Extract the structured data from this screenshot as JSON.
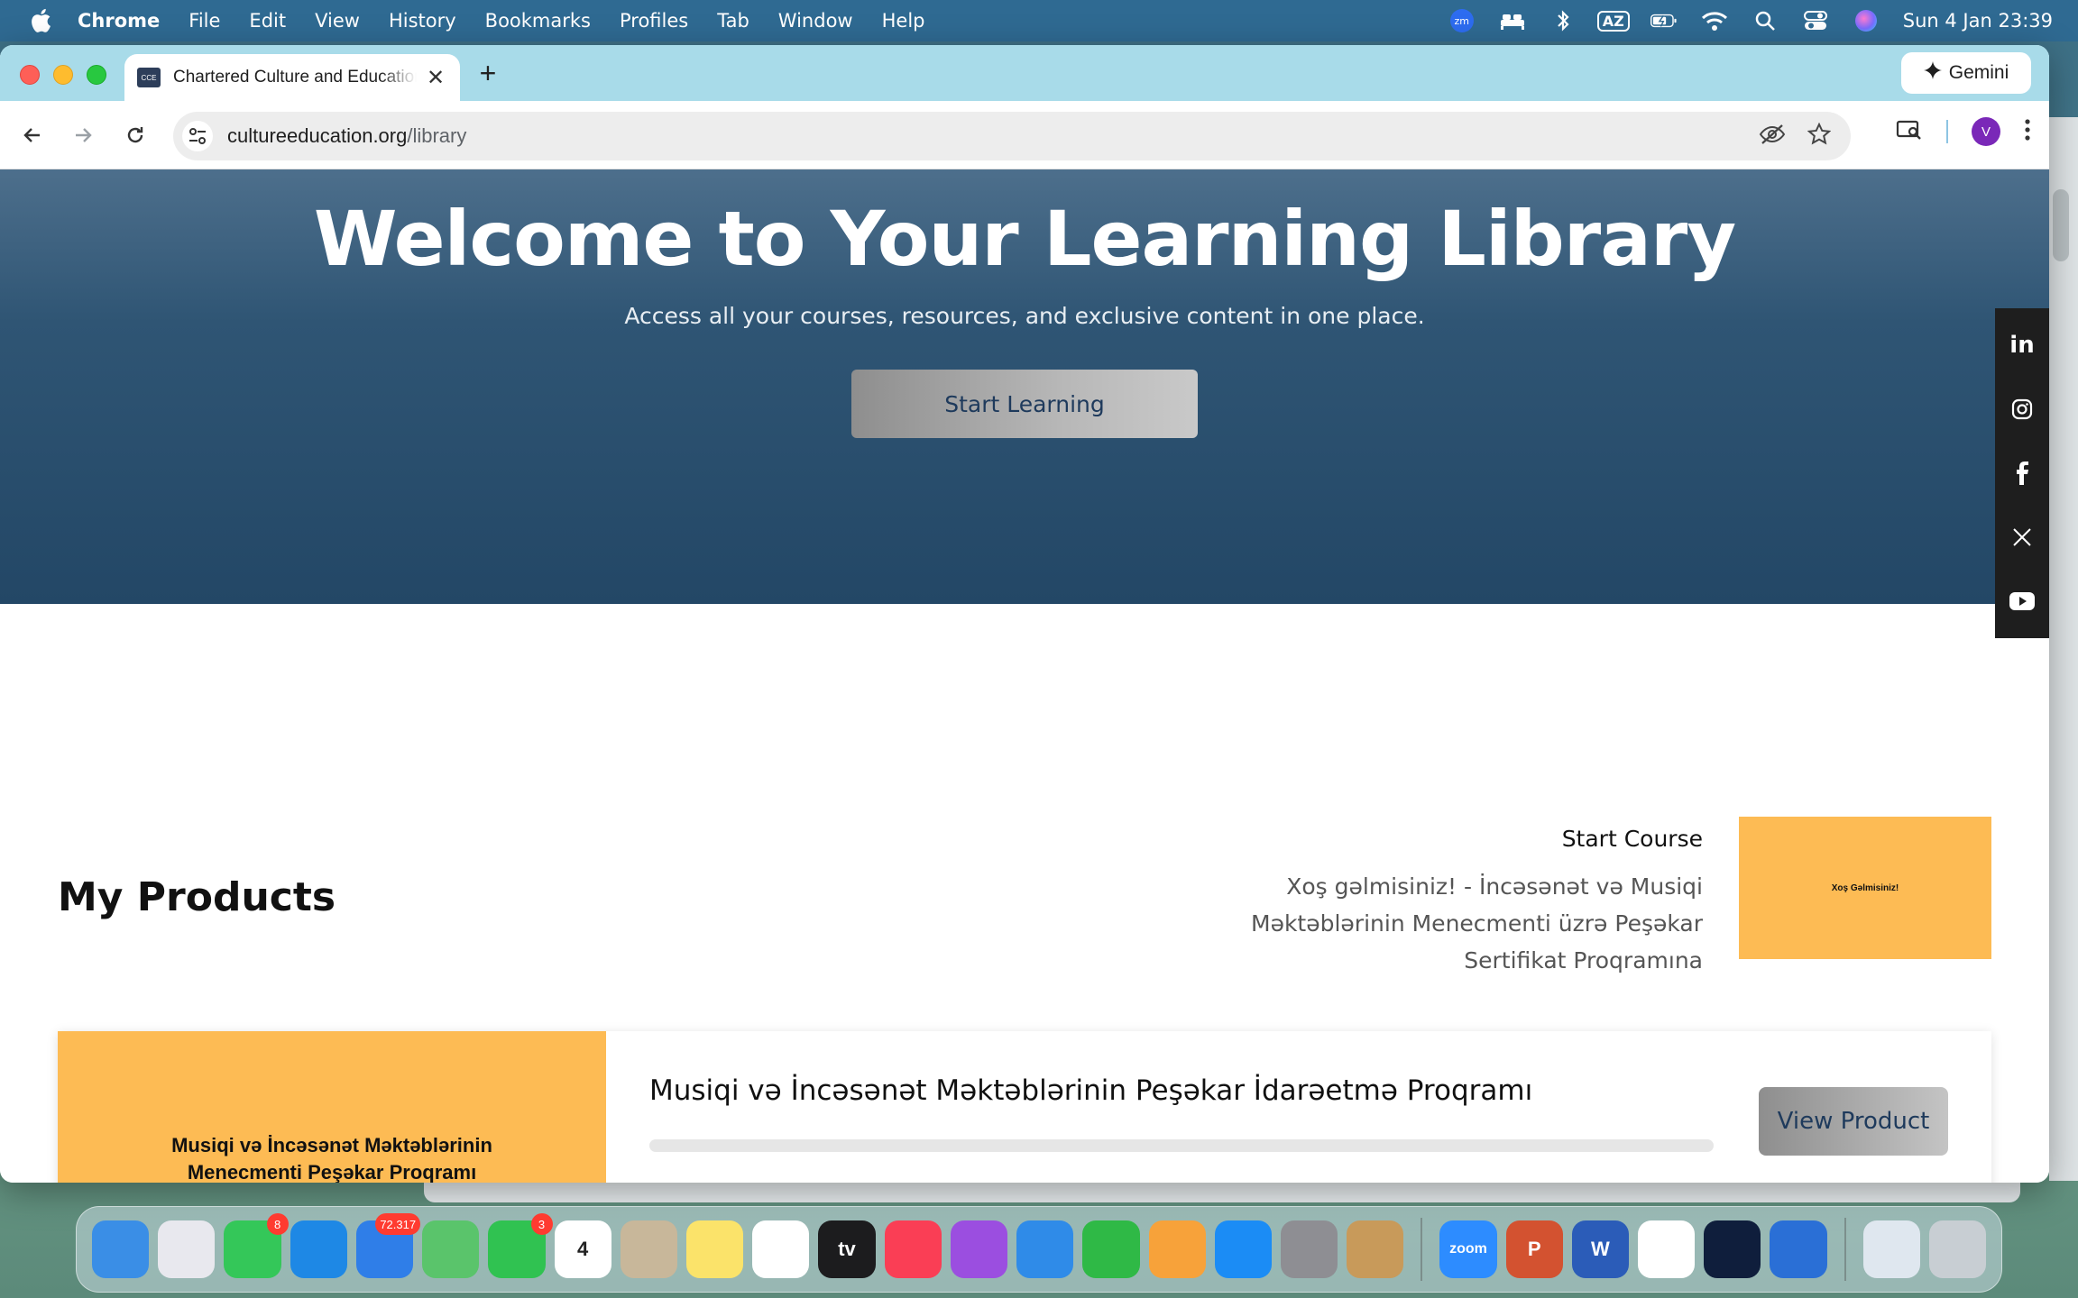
{
  "menubar": {
    "app_name": "Chrome",
    "items": [
      "File",
      "Edit",
      "View",
      "History",
      "Bookmarks",
      "Profiles",
      "Tab",
      "Window",
      "Help"
    ],
    "status_icons": [
      "zoom-icon",
      "bed-icon",
      "bluetooth-icon",
      "keyboard-layout-icon",
      "battery-icon",
      "wifi-icon",
      "spotlight-search-icon",
      "control-center-icon",
      "siri-icon"
    ],
    "keyboard_layout": "AZ",
    "zoom_label": "zm",
    "clock": "Sun 4 Jan  23:39"
  },
  "browser": {
    "tab_title": "Chartered Culture and Education",
    "favicon_text": "CCE",
    "gemini_label": "Gemini",
    "url_domain": "cultureeducation.org",
    "url_path": "/library",
    "profile_initial": "V"
  },
  "hero": {
    "title": "Welcome to Your Learning Library",
    "subtitle": "Access all your courses, resources, and exclusive content in one place.",
    "button_label": "Start Learning"
  },
  "social": [
    "linkedin-icon",
    "instagram-icon",
    "facebook-icon",
    "x-icon",
    "youtube-icon"
  ],
  "products": {
    "section_title": "My Products",
    "start_course": {
      "label": "Start Course",
      "lesson_title": "Xoş gəlmisiniz! - İncəsənət və Musiqi Məktəblərinin Menecmenti üzrə Peşəkar Sertifikat Proqramına",
      "thumbnail_text": "Xoş Gəlmisiniz!"
    },
    "items": [
      {
        "thumbnail_text": "Musiqi və İncəsənət Məktəblərinin Menecmenti Peşəkar Proqramı",
        "title": "Musiqi və İncəsənət Məktəblərinin Peşəkar İdarəetmə Proqramı",
        "progress": 0,
        "button_label": "View Product"
      }
    ]
  },
  "dock": {
    "apps": [
      {
        "name": "finder",
        "color": "#3a8ee6"
      },
      {
        "name": "launchpad",
        "color": "#e8e8ee"
      },
      {
        "name": "messages",
        "color": "#34c759",
        "badge": "8"
      },
      {
        "name": "safari",
        "color": "#1e88e5"
      },
      {
        "name": "mail",
        "color": "#2f7ee8",
        "badge": "72.317"
      },
      {
        "name": "maps",
        "color": "#5ac46b"
      },
      {
        "name": "facetime",
        "color": "#30c251",
        "badge": "3"
      },
      {
        "name": "calendar",
        "color": "#ffffff",
        "label": "4"
      },
      {
        "name": "contacts",
        "color": "#c8b79a"
      },
      {
        "name": "notes",
        "color": "#fbe36a"
      },
      {
        "name": "freeform",
        "color": "#ffffff"
      },
      {
        "name": "tv",
        "color": "#1c1c1e",
        "label": "tv"
      },
      {
        "name": "music",
        "color": "#fa3e55"
      },
      {
        "name": "podcasts",
        "color": "#9b4ee0"
      },
      {
        "name": "keynote",
        "color": "#2f8be8"
      },
      {
        "name": "numbers",
        "color": "#2fb946"
      },
      {
        "name": "pages",
        "color": "#f7a23a"
      },
      {
        "name": "app-store",
        "color": "#1b8cf5"
      },
      {
        "name": "system-settings",
        "color": "#8e8e93"
      },
      {
        "name": "archive-utility",
        "color": "#c89a5a"
      },
      {
        "name": "zoom",
        "color": "#2d8cff",
        "label": "zoom"
      },
      {
        "name": "powerpoint",
        "color": "#d35230",
        "label": "P"
      },
      {
        "name": "word",
        "color": "#2b5cb8",
        "label": "W"
      },
      {
        "name": "chrome",
        "color": "#ffffff"
      },
      {
        "name": "webex",
        "color": "#0f1e3c"
      },
      {
        "name": "preview-utility",
        "color": "#2a6fd6"
      },
      {
        "name": "downloads-stack",
        "color": "#dfe7ef"
      },
      {
        "name": "trash",
        "color": "#c8ced3"
      }
    ]
  }
}
